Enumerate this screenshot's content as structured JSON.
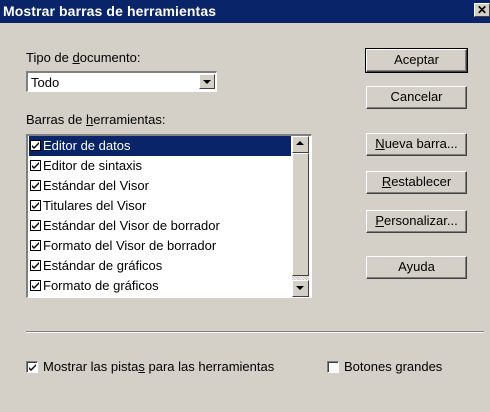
{
  "window": {
    "title": "Mostrar barras de herramientas",
    "close_glyph": "✕"
  },
  "document_type": {
    "label_before": "Tipo de ",
    "label_mnemonic": "d",
    "label_after": "ocumento:",
    "selected": "Todo"
  },
  "toolbars": {
    "label_before": "Barras de ",
    "label_mnemonic": "h",
    "label_after": "erramientas:",
    "items": [
      {
        "label": "Editor de datos",
        "checked": true,
        "selected": true
      },
      {
        "label": "Editor de sintaxis",
        "checked": true,
        "selected": false
      },
      {
        "label": "Estándar del Visor",
        "checked": true,
        "selected": false
      },
      {
        "label": "Titulares del Visor",
        "checked": true,
        "selected": false
      },
      {
        "label": "Estándar del Visor de borrador",
        "checked": true,
        "selected": false
      },
      {
        "label": "Formato del Visor de borrador",
        "checked": true,
        "selected": false
      },
      {
        "label": "Estándar de gráficos",
        "checked": true,
        "selected": false
      },
      {
        "label": "Formato de gráficos",
        "checked": true,
        "selected": false
      }
    ]
  },
  "buttons": {
    "accept": "Aceptar",
    "cancel": "Cancelar",
    "new_toolbar_mnemonic": "N",
    "new_toolbar_rest": "ueva barra...",
    "reset_mnemonic": "R",
    "reset_rest": "establecer",
    "customize_mnemonic": "P",
    "customize_rest": "ersonalizar...",
    "help": "Ayuda"
  },
  "options": {
    "show_tips": {
      "checked": true,
      "label_before": "Mostrar las pista",
      "label_mnemonic": "s",
      "label_after": " para las herramientas"
    },
    "large_buttons": {
      "checked": false,
      "label_before": "Botones ",
      "label_mnemonic": "g",
      "label_after": "randes"
    }
  },
  "colors": {
    "face": "#d4d0c8",
    "title_bar": "#0a246a",
    "selection": "#0a246a"
  }
}
